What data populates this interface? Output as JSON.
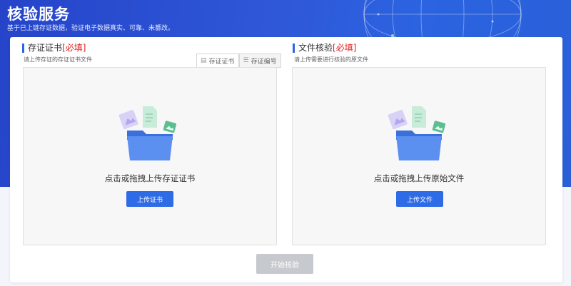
{
  "header": {
    "title": "核验服务",
    "subtitle": "基于已上链存证数据，验证电子数据真实、可靠、未篡改。"
  },
  "left_panel": {
    "title": "存证证书",
    "required": "[必填]",
    "hint": "请上传存证的存证证书文件",
    "tabs": [
      {
        "label": "存证证书",
        "icon": "document-icon",
        "active": true
      },
      {
        "label": "存证编号",
        "icon": "list-icon",
        "active": false
      }
    ],
    "drop_text": "点击或拖拽上传存证证书",
    "upload_button": "上传证书"
  },
  "right_panel": {
    "title": "文件核验",
    "required": "[必填]",
    "hint": "请上传需要进行核验的原文件",
    "drop_text": "点击或拖拽上传原始文件",
    "upload_button": "上传文件"
  },
  "footer": {
    "start_button": "开始核验"
  },
  "colors": {
    "accent": "#2e6be6",
    "banner": "#2a55d6",
    "required": "#e02020",
    "disabled_button": "#c6c9ce"
  }
}
